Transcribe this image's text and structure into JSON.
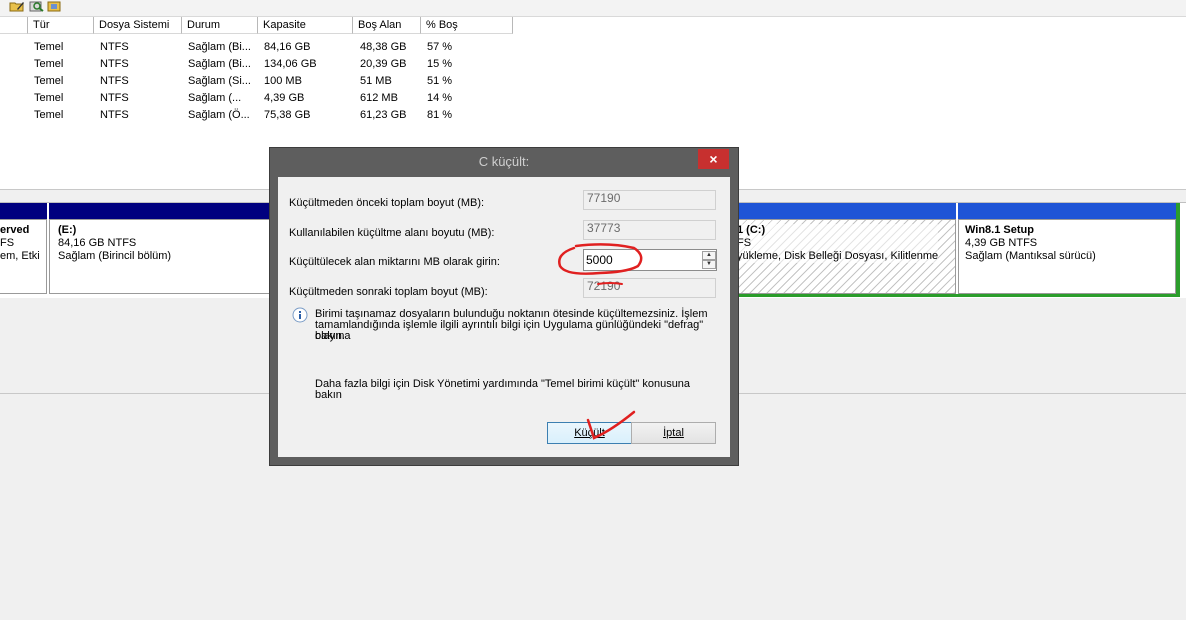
{
  "toolbar": {
    "icons": [
      "folder-edit-icon",
      "disk-search-icon",
      "disk-settings-icon"
    ]
  },
  "volume_list": {
    "columns": [
      "Tür",
      "Dosya Sistemi",
      "Durum",
      "Kapasite",
      "Boş Alan",
      "% Boş"
    ],
    "rows": [
      [
        "Temel",
        "NTFS",
        "Sağlam (Bi...",
        "84,16 GB",
        "48,38 GB",
        "57 %"
      ],
      [
        "Temel",
        "NTFS",
        "Sağlam (Bi...",
        "134,06 GB",
        "20,39 GB",
        "15 %"
      ],
      [
        "Temel",
        "NTFS",
        "Sağlam (Si...",
        "100 MB",
        "51 MB",
        "51 %"
      ],
      [
        "Temel",
        "NTFS",
        "Sağlam (...",
        "4,39 GB",
        "612 MB",
        "14 %"
      ],
      [
        "Temel",
        "NTFS",
        "Sağlam (Ö...",
        "75,38 GB",
        "61,23 GB",
        "81 %"
      ]
    ]
  },
  "disk_map": {
    "reserved": {
      "line1": "erved",
      "line2": "FS",
      "line3": "em, Etki"
    },
    "e_drive": {
      "line1": "(E:)",
      "line2": "84,16 GB NTFS",
      "line3": "Sağlam (Birincil bölüm)"
    },
    "c_drive": {
      "line1": "1  (C:)",
      "line2": "FS",
      "line3": "yükleme, Disk Belleği Dosyası, Kilitlenme"
    },
    "win81": {
      "line1": "Win8.1 Setup",
      "line2": "4,39 GB NTFS",
      "line3": "Sağlam (Mantıksal sürücü)"
    },
    "colors": {
      "primary_bar": "#00007f",
      "logical_bar": "#1e54d6",
      "extended_border": "#2b9d2b"
    }
  },
  "dialog": {
    "title": "C küçült:",
    "close_label": "×",
    "total_before_label": "Küçültmeden önceki toplam boyut (MB):",
    "total_before_value": "77190",
    "available_label": "Kullanılabilen küçültme alanı boyutu (MB):",
    "available_value": "37773",
    "amount_label": "Küçültülecek alan miktarını MB olarak girin:",
    "amount_value": "5000",
    "total_after_label": "Küçültmeden sonraki toplam boyut (MB):",
    "total_after_value": "72190",
    "info_icon": "info-icon",
    "info_line1": "Birimi taşınamaz dosyaların bulunduğu noktanın ötesinde küçültemezsiniz. İşlem",
    "info_line2": "tamamlandığında işlemle ilgili ayrıntılı bilgi için Uygulama günlüğündeki \"defrag\" olayına",
    "info_line3": "bakın.",
    "help_line1": "Daha fazla bilgi için Disk Yönetimi yardımında \"Temel birimi küçült\" konusuna",
    "help_line2": "bakın",
    "shrink_label": "Küçült",
    "cancel_label": "İptal"
  }
}
